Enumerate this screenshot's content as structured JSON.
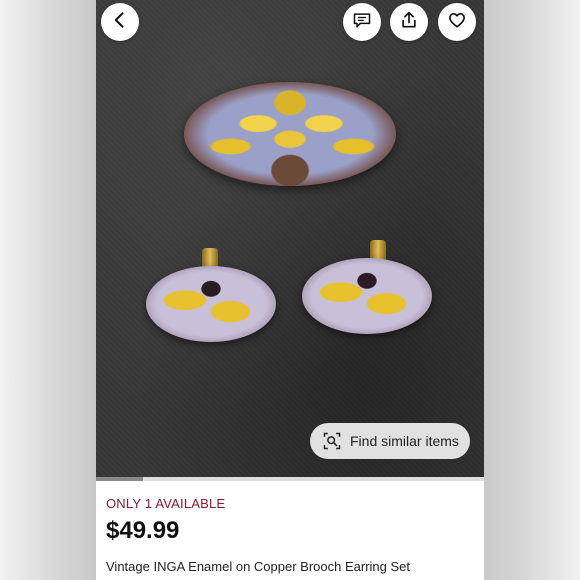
{
  "header": {
    "back_icon": "chevron-left-icon",
    "message_icon": "message-icon",
    "share_icon": "share-icon",
    "like_icon": "heart-icon"
  },
  "photo": {
    "find_similar_label": "Find similar items",
    "find_similar_icon": "image-search-icon",
    "carousel_position": 0.12
  },
  "listing": {
    "availability": "ONLY 1 AVAILABLE",
    "price": "$49.99",
    "title": "Vintage INGA  Enamel on Copper Brooch Earring Set"
  },
  "colors": {
    "availability_text": "#8a1830",
    "price_text": "#111111"
  }
}
